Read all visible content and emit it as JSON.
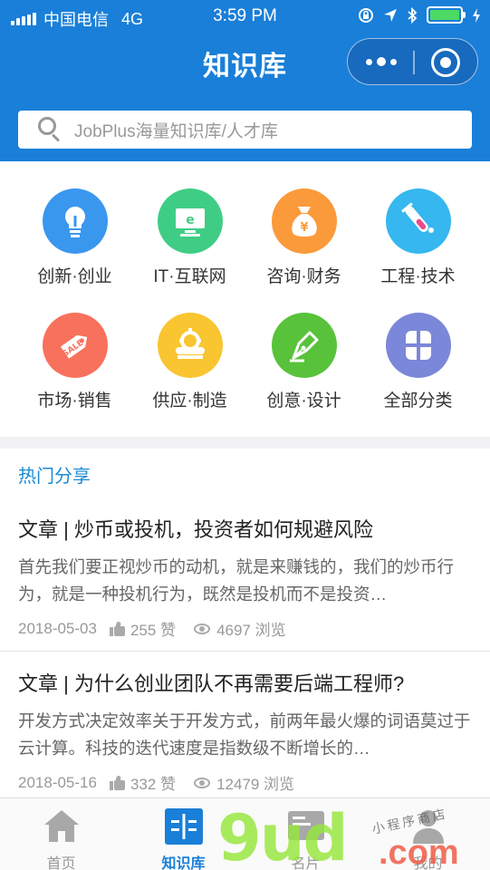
{
  "status_bar": {
    "carrier": "中国电信",
    "network": "4G",
    "time": "3:59 PM"
  },
  "nav": {
    "title": "知识库"
  },
  "search": {
    "placeholder": "JobPlus海量知识库/人才库"
  },
  "categories": [
    {
      "label": "创新·创业",
      "icon": "lightbulb-icon",
      "color": "#3a97ee"
    },
    {
      "label": "IT·互联网",
      "icon": "monitor-icon",
      "color": "#3fcd85"
    },
    {
      "label": "咨询·财务",
      "icon": "money-bag-icon",
      "color": "#fb9a3a"
    },
    {
      "label": "工程·技术",
      "icon": "test-tube-icon",
      "color": "#36b7ef"
    },
    {
      "label": "市场·销售",
      "icon": "sale-tag-icon",
      "color": "#f8715c"
    },
    {
      "label": "供应·制造",
      "icon": "factory-icon",
      "color": "#f9c530"
    },
    {
      "label": "创意·设计",
      "icon": "pen-nib-icon",
      "color": "#58c23a"
    },
    {
      "label": "全部分类",
      "icon": "grid-icon",
      "color": "#7b87d8"
    }
  ],
  "feed": {
    "section_title": "热门分享",
    "articles": [
      {
        "title": "文章 | 炒币或投机，投资者如何规避风险",
        "summary": "首先我们要正视炒币的动机，就是来赚钱的，我们的炒币行为，就是一种投机行为，既然是投机而不是投资…",
        "date": "2018-05-03",
        "likes": "255 赞",
        "views": "4697 浏览"
      },
      {
        "title": "文章 | 为什么创业团队不再需要后端工程师?",
        "summary": "开发方式决定效率关于开发方式，前两年最火爆的词语莫过于云计算。科技的迭代速度是指数级不断增长的…",
        "date": "2018-05-16",
        "likes": "332 赞",
        "views": "12479 浏览"
      }
    ]
  },
  "tabbar": {
    "tabs": [
      {
        "label": "首页",
        "icon": "home-icon"
      },
      {
        "label": "知识库",
        "icon": "knowledge-icon",
        "active": true
      },
      {
        "label": "名片",
        "icon": "card-icon"
      },
      {
        "label": "我的",
        "icon": "person-icon"
      }
    ]
  },
  "watermark": {
    "brand": "9ud",
    "domain": ".com",
    "caption": "小程序商店"
  },
  "colors": {
    "primary": "#1a7fd8",
    "section_title": "#1a8bd4"
  }
}
